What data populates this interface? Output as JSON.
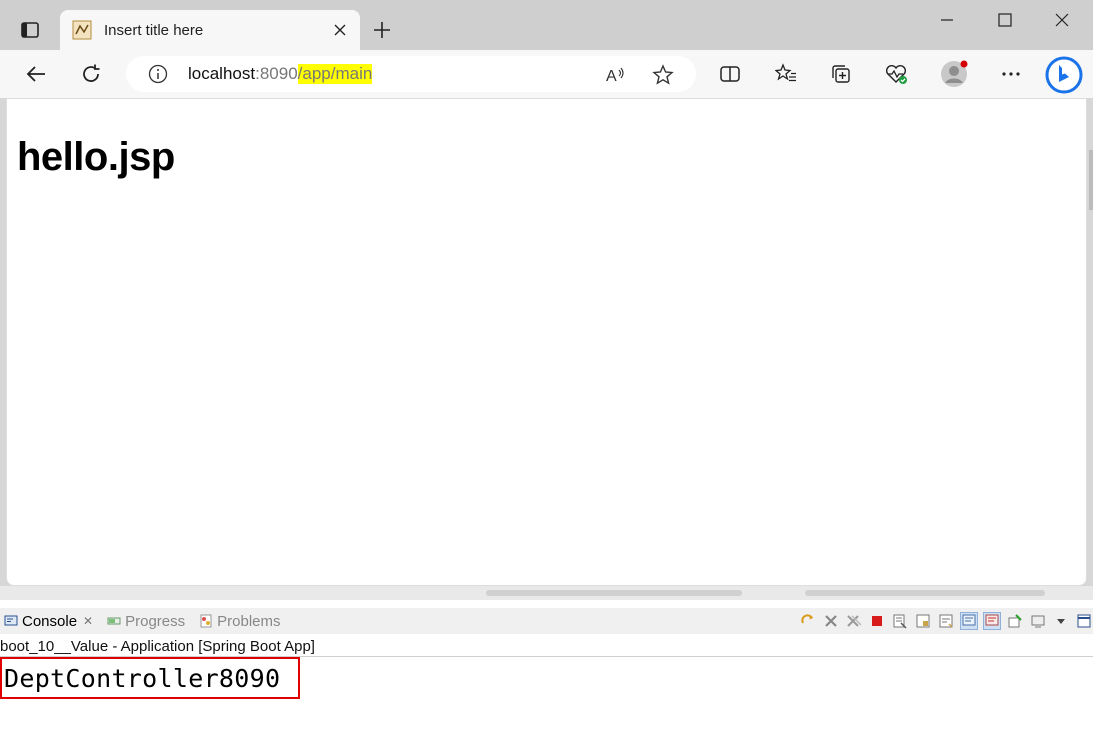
{
  "browser": {
    "tab": {
      "title": "Insert title here"
    },
    "address": {
      "host": "localhost",
      "port": ":8090",
      "path": "/app/main"
    }
  },
  "page": {
    "heading": "hello.jsp"
  },
  "eclipse": {
    "tabs": [
      {
        "label": "Console"
      },
      {
        "label": "Progress"
      },
      {
        "label": "Problems"
      }
    ],
    "launch_label": "boot_10__Value - Application [Spring Boot App]",
    "console_output": "DeptController8090"
  },
  "colors": {
    "highlight": "#ffff00",
    "annotation_box": "#e00000",
    "bing_blue": "#1a73e8"
  }
}
